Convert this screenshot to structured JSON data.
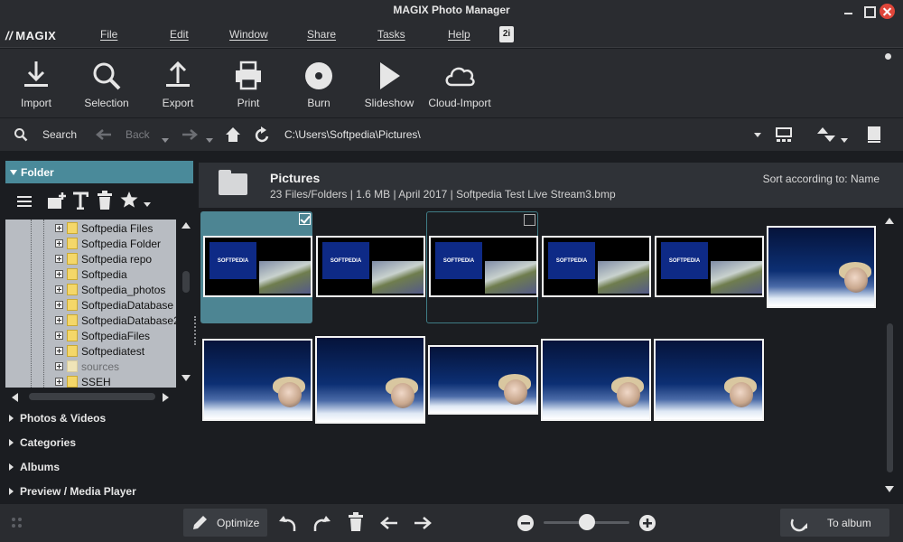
{
  "window": {
    "title": "MAGIX Photo Manager"
  },
  "menubar": {
    "logo": "MAGIX",
    "items": [
      "File",
      "Edit",
      "Window",
      "Share",
      "Tasks",
      "Help"
    ],
    "extra_icon": "2i"
  },
  "toolbar": {
    "tools": [
      {
        "label": "Import",
        "icon": "import-icon"
      },
      {
        "label": "Selection",
        "icon": "magnifier-icon"
      },
      {
        "label": "Export",
        "icon": "export-icon"
      },
      {
        "label": "Print",
        "icon": "printer-icon"
      },
      {
        "label": "Burn",
        "icon": "disc-icon"
      },
      {
        "label": "Slideshow",
        "icon": "play-icon"
      },
      {
        "label": "Cloud-Import",
        "icon": "cloud-icon"
      }
    ]
  },
  "navbar": {
    "search_label": "Search",
    "back_label": "Back",
    "path": "C:\\Users\\Softpedia\\Pictures\\"
  },
  "leftpanel": {
    "folder_header": "Folder",
    "tree": [
      {
        "name": "Softpedia Files",
        "dim": false
      },
      {
        "name": "Softpedia Folder",
        "dim": false
      },
      {
        "name": "Softpedia repo",
        "dim": false
      },
      {
        "name": "Softpedia",
        "dim": false
      },
      {
        "name": "Softpedia_photos",
        "dim": false
      },
      {
        "name": "SoftpediaDatabase",
        "dim": false
      },
      {
        "name": "SoftpediaDatabase2",
        "dim": false
      },
      {
        "name": "SoftpediaFiles",
        "dim": false
      },
      {
        "name": "Softpediatest",
        "dim": false
      },
      {
        "name": "sources",
        "dim": true
      },
      {
        "name": "SSEH",
        "dim": false
      }
    ],
    "sections": [
      "Photos & Videos",
      "Categories",
      "Albums",
      "Preview / Media Player"
    ]
  },
  "content": {
    "folder_title": "Pictures",
    "info": "23 Files/Folders | 1.6 MB | April 2017 | Softpedia Test Live Stream3.bmp",
    "sort_label": "Sort according to: Name",
    "thumbnail_logo_text": "SOFTPEDIA"
  },
  "bottombar": {
    "optimize_label": "Optimize",
    "to_album_label": "To album",
    "zoom_level": 0.5
  },
  "colors": {
    "accent": "#4a8a9a",
    "background": "#1b1d21",
    "panel": "#2a2c30"
  }
}
